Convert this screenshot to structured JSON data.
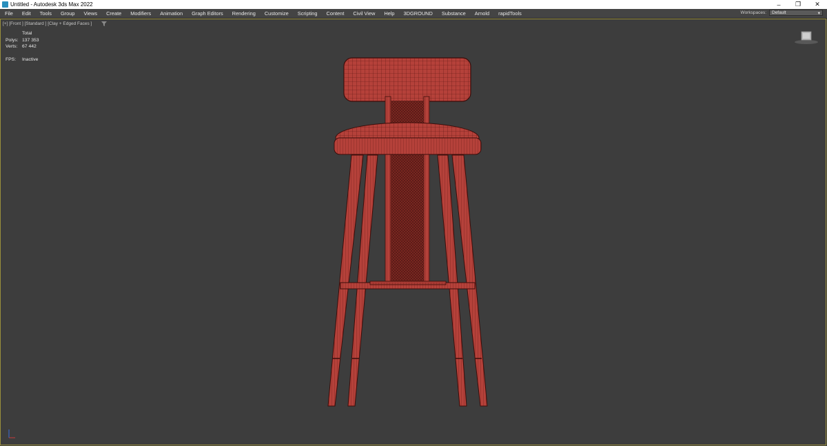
{
  "window": {
    "title": "Untitled - Autodesk 3ds Max 2022",
    "controls": {
      "minimize": "–",
      "restore": "❐",
      "close": "✕"
    }
  },
  "menu": {
    "items": [
      "File",
      "Edit",
      "Tools",
      "Group",
      "Views",
      "Create",
      "Modifiers",
      "Animation",
      "Graph Editors",
      "Rendering",
      "Customize",
      "Scripting",
      "Content",
      "Civil View",
      "Help",
      "3DGROUND",
      "Substance",
      "Arnold",
      "rapidTools"
    ],
    "workspaces_label": "Workspaces:",
    "workspaces_value": "Default"
  },
  "viewport": {
    "label": "[+] [Front ] [Standard ] [Clay + Edged Faces ]",
    "filter_icon": "funnel-icon",
    "stats": {
      "header": "Total",
      "polys_label": "Polys:",
      "polys_value": "137 353",
      "verts_label": "Verts:",
      "verts_value": "67 442",
      "fps_label": "FPS:",
      "fps_value": "Inactive"
    },
    "border_color": "#9a8f3c",
    "model_color": "#b5413a",
    "wire_color": "#5a1410"
  }
}
